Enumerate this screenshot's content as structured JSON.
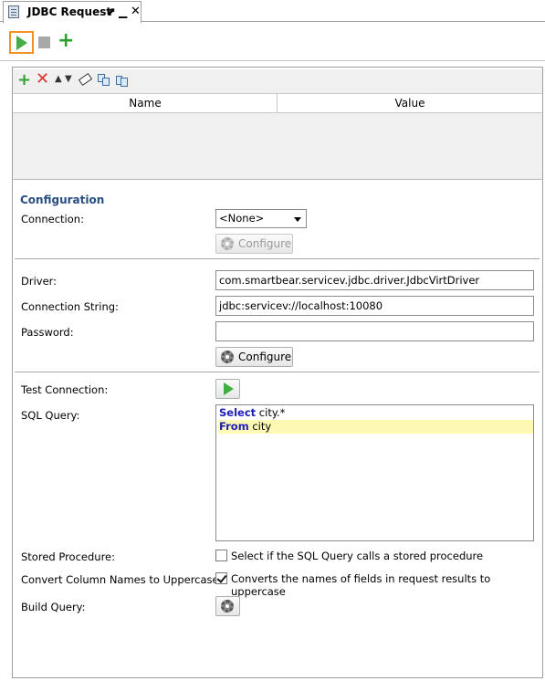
{
  "tab": {
    "title": "JDBC Request",
    "pin": "⬈",
    "minimize": "▁",
    "close": "✕"
  },
  "toolbar": {
    "add_symbol": "+"
  },
  "properties_grid": {
    "add_symbol": "+",
    "delete_symbol": "✕",
    "up_symbol": "▲",
    "down_symbol": "▼",
    "columns": [
      "Name",
      "Value"
    ],
    "rows": []
  },
  "config": {
    "section_title": "Configuration",
    "connection_label": "Connection:",
    "connection_value": "<None>",
    "configure_label": "Configure",
    "driver_label": "Driver:",
    "driver_value": "com.smartbear.servicev.jdbc.driver.JdbcVirtDriver",
    "connection_string_label": "Connection String:",
    "connection_string_value": "jdbc:servicev://localhost:10080",
    "password_label": "Password:",
    "password_value": "",
    "configure2_label": "Configure",
    "test_connection_label": "Test Connection:",
    "sql_query_label": "SQL Query:",
    "sql": {
      "line1_kw": "Select",
      "line1_rest": " city.*",
      "line2_kw": "From",
      "line2_rest": " city"
    },
    "stored_procedure_label": "Stored Procedure:",
    "stored_procedure_text": "Select if the SQL Query calls a stored procedure",
    "stored_procedure_checked": false,
    "uppercase_label": "Convert Column Names to Uppercase:",
    "uppercase_text": "Converts the names of fields in request results to uppercase",
    "uppercase_checked": true,
    "build_query_label": "Build Query:"
  },
  "colors": {
    "accent_orange": "#f39125",
    "run_green": "#3fb03f",
    "section_blue": "#274f82",
    "keyword_blue": "#1d1db8",
    "highlight": "#fdf8b4"
  }
}
